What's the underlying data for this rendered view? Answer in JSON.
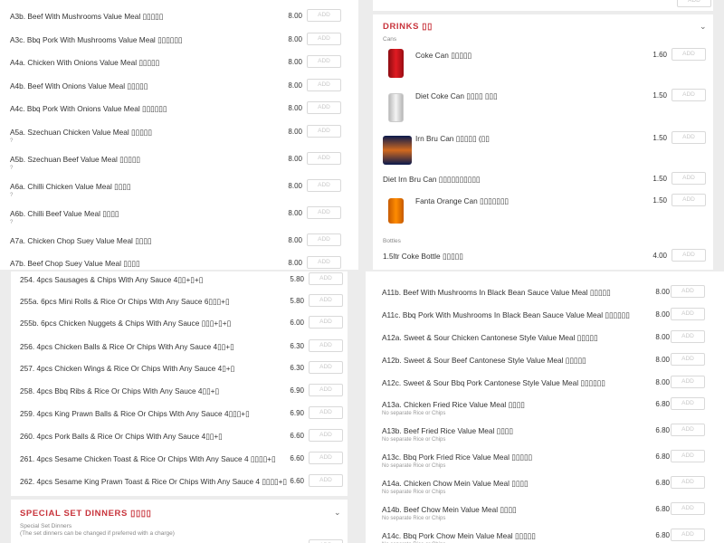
{
  "add_label": "ADD",
  "q1": {
    "items": [
      {
        "name": "A3b. Beef With Mushrooms Value Meal ▯▯▯▯▯",
        "price": "8.00",
        "note": ""
      },
      {
        "name": "A3c. Bbq Pork With Mushrooms Value Meal ▯▯▯▯▯▯",
        "price": "8.00",
        "note": ""
      },
      {
        "name": "A4a. Chicken With Onions Value Meal ▯▯▯▯▯",
        "price": "8.00",
        "note": ""
      },
      {
        "name": "A4b. Beef With Onions Value Meal ▯▯▯▯▯",
        "price": "8.00",
        "note": ""
      },
      {
        "name": "A4c. Bbq Pork With Onions Value Meal ▯▯▯▯▯▯",
        "price": "8.00",
        "note": ""
      },
      {
        "name": "A5a. Szechuan Chicken Value Meal ▯▯▯▯▯",
        "price": "8.00",
        "note": "?"
      },
      {
        "name": "A5b. Szechuan Beef Value Meal ▯▯▯▯▯",
        "price": "8.00",
        "note": "?"
      },
      {
        "name": "A6a. Chilli Chicken Value Meal ▯▯▯▯",
        "price": "8.00",
        "note": "?"
      },
      {
        "name": "A6b. Chilli Beef Value Meal ▯▯▯▯",
        "price": "8.00",
        "note": "?"
      },
      {
        "name": "A7a. Chicken Chop Suey Value Meal ▯▯▯▯",
        "price": "8.00",
        "note": ""
      },
      {
        "name": "A7b. Beef Chop Suey Value Meal ▯▯▯▯",
        "price": "8.00",
        "note": ""
      }
    ]
  },
  "q2": {
    "title": "DRINKS ▯▯",
    "cans_label": "Cans",
    "bottles_label": "Bottles",
    "items": [
      {
        "name": "Coke Can ▯▯▯▯▯",
        "price": "1.60",
        "image": "coke-can"
      },
      {
        "name": "Diet Coke Can ▯▯▯▯ ▯▯▯",
        "price": "1.50",
        "image": "diet-coke-can"
      },
      {
        "name": "Irn Bru Can ▯▯▯▯▯ (▯▯",
        "price": "1.50",
        "image": "irn-bru-can"
      },
      {
        "name": "Diet Irn Bru Can ▯▯▯▯▯▯▯▯▯▯",
        "price": "1.50",
        "image": ""
      },
      {
        "name": "Fanta Orange Can ▯▯▯▯▯▯▯",
        "price": "1.50",
        "image": "fanta-can"
      },
      {
        "name": "1.5ltr Coke Bottle ▯▯▯▯▯",
        "price": "4.00",
        "image": ""
      }
    ]
  },
  "q3": {
    "items": [
      {
        "name": "254. 4pcs Sausages & Chips With Any Sauce 4▯▯+▯+▯",
        "price": "5.80"
      },
      {
        "name": "255a. 6pcs Mini Rolls & Rice Or Chips With Any Sauce 6▯▯▯+▯",
        "price": "5.80"
      },
      {
        "name": "255b. 6pcs Chicken Nuggets & Chips With Any Sauce ▯▯▯+▯+▯",
        "price": "6.00"
      },
      {
        "name": "256. 4pcs Chicken Balls & Rice Or Chips With Any Sauce 4▯▯+▯",
        "price": "6.30"
      },
      {
        "name": "257. 4pcs Chicken Wings & Rice Or Chips With Any Sauce 4▯+▯",
        "price": "6.30"
      },
      {
        "name": "258. 4pcs Bbq Ribs & Rice Or Chips With Any Sauce 4▯▯+▯",
        "price": "6.90"
      },
      {
        "name": "259. 4pcs King Prawn Balls & Rice Or Chips With Any Sauce 4▯▯▯+▯",
        "price": "6.90"
      },
      {
        "name": "260. 4pcs Pork Balls & Rice Or Chips With Any Sauce 4▯▯+▯",
        "price": "6.60"
      },
      {
        "name": "261. 4pcs Sesame Chicken Toast & Rice Or Chips With Any Sauce 4 ▯▯▯▯+▯",
        "price": "6.60"
      },
      {
        "name": "262. 4pcs Sesame King Prawn Toast & Rice Or Chips With Any Sauce 4 ▯▯▯▯+▯",
        "price": "6.60"
      }
    ],
    "section_title": "SPECIAL SET DINNERS ▯▯▯▯",
    "section_sub1": "Special Set Dinners",
    "section_sub2": "(The set dinners can be changed if preferred with a charge)"
  },
  "q4": {
    "items": [
      {
        "name": "A11b. Beef With Mushrooms In Black Bean Sauce Value Meal ▯▯▯▯▯",
        "price": "8.00",
        "note": ""
      },
      {
        "name": "A11c. Bbq Pork With Mushrooms In Black Bean Sauce Value Meal ▯▯▯▯▯▯",
        "price": "8.00",
        "note": ""
      },
      {
        "name": "A12a. Sweet & Sour Chicken Cantonese Style Value Meal ▯▯▯▯▯",
        "price": "8.00",
        "note": ""
      },
      {
        "name": "A12b. Sweet & Sour Beef Cantonese Style Value Meal ▯▯▯▯▯",
        "price": "8.00",
        "note": ""
      },
      {
        "name": "A12c. Sweet & Sour Bbq Pork Cantonese Style Value Meal ▯▯▯▯▯▯",
        "price": "8.00",
        "note": ""
      },
      {
        "name": "A13a. Chicken Fried Rice Value Meal ▯▯▯▯",
        "price": "6.80",
        "note": "No separate Rice or Chips"
      },
      {
        "name": "A13b. Beef Fried Rice Value Meal ▯▯▯▯",
        "price": "6.80",
        "note": "No separate Rice or Chips"
      },
      {
        "name": "A13c. Bbq Pork Fried Rice Value Meal ▯▯▯▯▯",
        "price": "6.80",
        "note": "No separate Rice or Chips"
      },
      {
        "name": "A14a. Chicken Chow Mein Value Meal ▯▯▯▯",
        "price": "6.80",
        "note": "No separate Rice or Chips"
      },
      {
        "name": "A14b. Beef Chow Mein Value Meal ▯▯▯▯",
        "price": "6.80",
        "note": "No separate Rice or Chips"
      },
      {
        "name": "A14c. Bbq Pork Chow Mein Value Meal ▯▯▯▯▯",
        "price": "6.80",
        "note": "No separate Rice or Chips"
      }
    ]
  }
}
